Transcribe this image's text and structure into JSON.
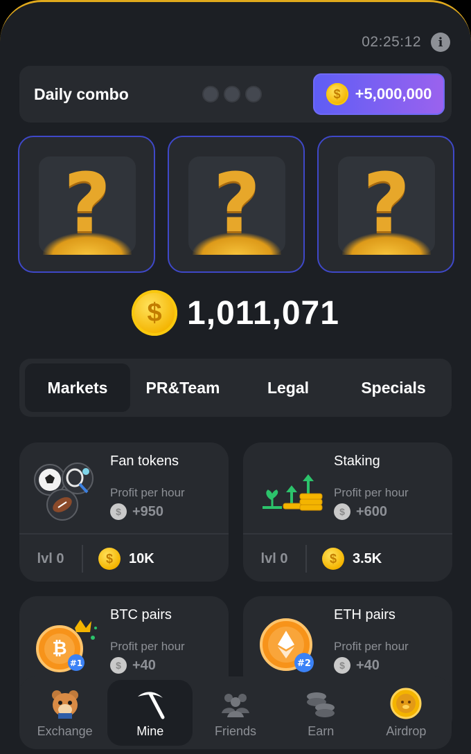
{
  "header": {
    "timer": "02:25:12",
    "info_label": "i"
  },
  "combo": {
    "title": "Daily combo",
    "reward": "+5,000,000",
    "coin_symbol": "$"
  },
  "mystery_cards": [
    {
      "symbol": "?"
    },
    {
      "symbol": "?"
    },
    {
      "symbol": "?"
    }
  ],
  "balance": {
    "value": "1,011,071",
    "coin_symbol": "$"
  },
  "tabs": [
    {
      "label": "Markets"
    },
    {
      "label": "PR&Team"
    },
    {
      "label": "Legal"
    },
    {
      "label": "Specials"
    }
  ],
  "cards": [
    {
      "name": "Fan tokens",
      "pph_label": "Profit per hour",
      "profit": "+950",
      "level": "lvl 0",
      "price": "10K",
      "icon": "sports-balls-icon"
    },
    {
      "name": "Staking",
      "pph_label": "Profit per hour",
      "profit": "+600",
      "level": "lvl 0",
      "price": "3.5K",
      "icon": "staking-growth-icon"
    },
    {
      "name": "BTC pairs",
      "pph_label": "Profit per hour",
      "profit": "+40",
      "badge": "#1",
      "icon": "bitcoin-coin-icon",
      "coin_symbol": "₿"
    },
    {
      "name": "ETH pairs",
      "pph_label": "Profit per hour",
      "profit": "+40",
      "badge": "#2",
      "icon": "ethereum-coin-icon"
    }
  ],
  "nav": [
    {
      "label": "Exchange",
      "icon": "hamster-icon"
    },
    {
      "label": "Mine",
      "icon": "pickaxe-icon"
    },
    {
      "label": "Friends",
      "icon": "friends-icon"
    },
    {
      "label": "Earn",
      "icon": "coins-stack-icon"
    },
    {
      "label": "Airdrop",
      "icon": "airdrop-coin-icon"
    }
  ],
  "colors": {
    "accent": "#f4b400",
    "purple_btn": "#7a60f0",
    "card_border": "#3f48c9",
    "bg": "#1c1f24",
    "panel": "#272a2f"
  }
}
